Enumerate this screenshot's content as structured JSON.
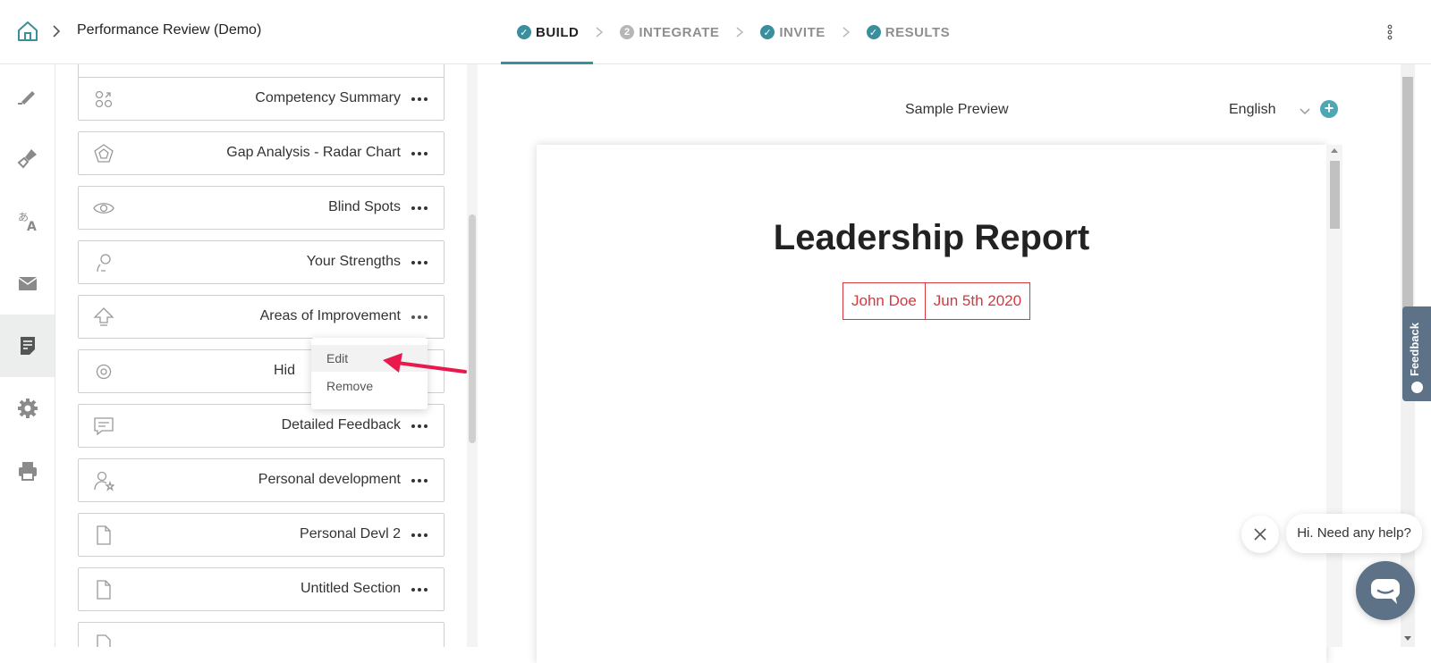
{
  "header": {
    "breadcrumb_title": "Performance Review (Demo)",
    "steps": [
      {
        "label": "BUILD",
        "badge": "✓",
        "state": "active"
      },
      {
        "label": "INTEGRATE",
        "badge": "2",
        "state": "pending"
      },
      {
        "label": "INVITE",
        "badge": "✓",
        "state": "done"
      },
      {
        "label": "RESULTS",
        "badge": "✓",
        "state": "done"
      }
    ]
  },
  "rail": {
    "items": [
      {
        "icon": "pencil-icon"
      },
      {
        "icon": "paint-brush-icon"
      },
      {
        "icon": "translate-icon"
      },
      {
        "icon": "envelope-icon"
      },
      {
        "icon": "report-icon",
        "active": true
      },
      {
        "icon": "gear-icon"
      },
      {
        "icon": "printer-icon"
      }
    ]
  },
  "sections": {
    "items": [
      {
        "label": "Competency Summary",
        "icon": "circles-icon"
      },
      {
        "label": "Gap Analysis - Radar Chart",
        "icon": "radar-icon"
      },
      {
        "label": "Blind Spots",
        "icon": "eye-icon"
      },
      {
        "label": "Your Strengths",
        "icon": "lightbulb-icon"
      },
      {
        "label": "Areas of Improvement",
        "icon": "arrow-up-icon"
      },
      {
        "label": "Hid",
        "icon": "gear-icon"
      },
      {
        "label": "Detailed Feedback",
        "icon": "comment-icon"
      },
      {
        "label": "Personal development",
        "icon": "user-star-icon"
      },
      {
        "label": "Personal Devl 2",
        "icon": "document-icon"
      },
      {
        "label": "Untitled Section",
        "icon": "document-icon"
      }
    ],
    "menu": {
      "edit_label": "Edit",
      "remove_label": "Remove"
    }
  },
  "preview": {
    "title": "Sample Preview",
    "language": "English",
    "add_language": "+",
    "doc_title": "Leadership Report",
    "name": "John Doe",
    "date": "Jun 5th 2020"
  },
  "feedback_tab": {
    "label": "Feedback"
  },
  "chat": {
    "greeting": "Hi. Need any help?"
  },
  "colors": {
    "accent": "#3a8f9c",
    "report_red": "#d9363e",
    "arrow": "#e8194c",
    "widget": "#5d7287"
  }
}
